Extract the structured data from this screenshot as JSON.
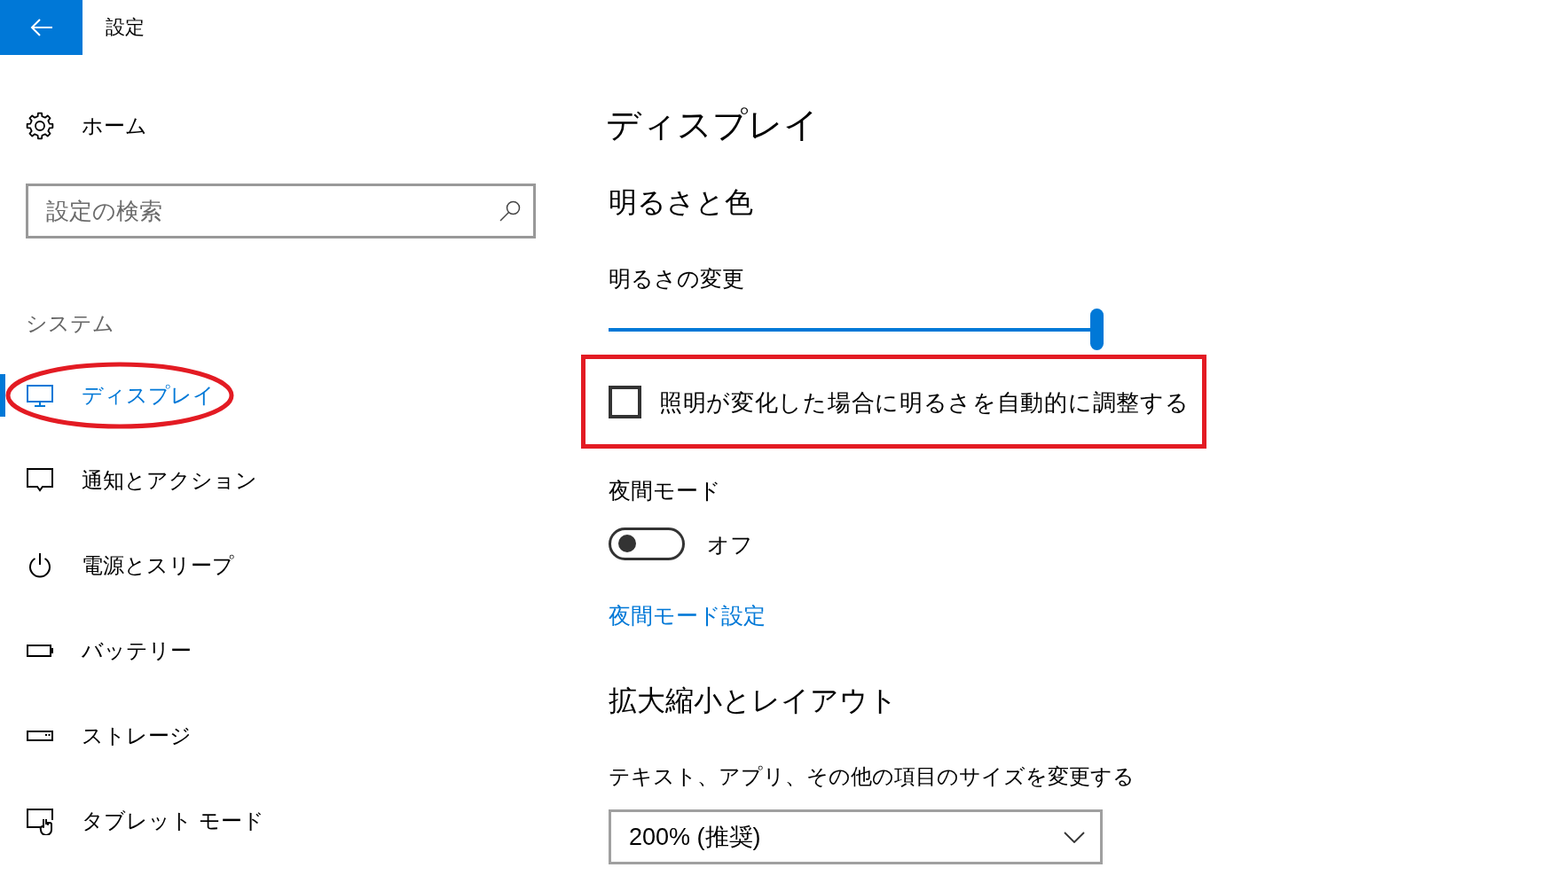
{
  "window": {
    "title": "設定"
  },
  "sidebar": {
    "home": {
      "label": "ホーム"
    },
    "search": {
      "placeholder": "設定の検索"
    },
    "section": "システム",
    "items": [
      {
        "label": "ディスプレイ",
        "selected": true,
        "highlighted": true
      },
      {
        "label": "通知とアクション",
        "selected": false,
        "highlighted": false
      },
      {
        "label": "電源とスリープ",
        "selected": false,
        "highlighted": false
      },
      {
        "label": "バッテリー",
        "selected": false,
        "highlighted": false
      },
      {
        "label": "ストレージ",
        "selected": false,
        "highlighted": false
      },
      {
        "label": "タブレット モード",
        "selected": false,
        "highlighted": false
      }
    ]
  },
  "content": {
    "title": "ディスプレイ",
    "sections": [
      {
        "heading": "明るさと色",
        "controls": [
          {
            "kind": "slider",
            "label": "明るさの変更",
            "level": 1.0
          },
          {
            "kind": "checkbox",
            "label": "照明が変化した場合に明るさを自動的に調整する",
            "checked": false,
            "highlighted": true
          },
          {
            "kind": "toggle",
            "label": "夜間モード",
            "on": false,
            "state_text": "オフ"
          },
          {
            "kind": "link",
            "label": "夜間モード設定"
          }
        ]
      },
      {
        "heading": "拡大縮小とレイアウト",
        "controls": [
          {
            "kind": "dropdown",
            "label": "テキスト、アプリ、その他の項目のサイズを変更する",
            "value": "200% (推奨)"
          }
        ]
      }
    ]
  }
}
